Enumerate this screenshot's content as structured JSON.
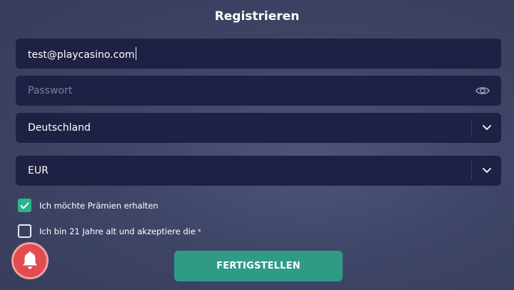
{
  "form": {
    "title": "Registrieren",
    "email": {
      "value": "test@playcasino.com"
    },
    "password": {
      "placeholder": "Passwort",
      "icon": "eye-icon"
    },
    "country": {
      "selected": "Deutschland",
      "icon": "chevron-down-icon"
    },
    "currency": {
      "selected": "EUR",
      "icon": "chevron-down-icon"
    },
    "bonus_checkbox": {
      "label": "Ich möchte Prämien erhalten",
      "checked": true
    },
    "age_checkbox": {
      "label": "Ich bin 21 Jahre alt und akzeptiere die",
      "required_marker": "*",
      "checked": false
    },
    "submit_label": "FERTIGSTELLEN"
  },
  "notification": {
    "icon": "bell-icon"
  },
  "colors": {
    "field_bg": "#1e2044",
    "accent_green": "#2cb38a",
    "button_bg": "#2f9b87",
    "bell_red": "#e24b4f"
  }
}
